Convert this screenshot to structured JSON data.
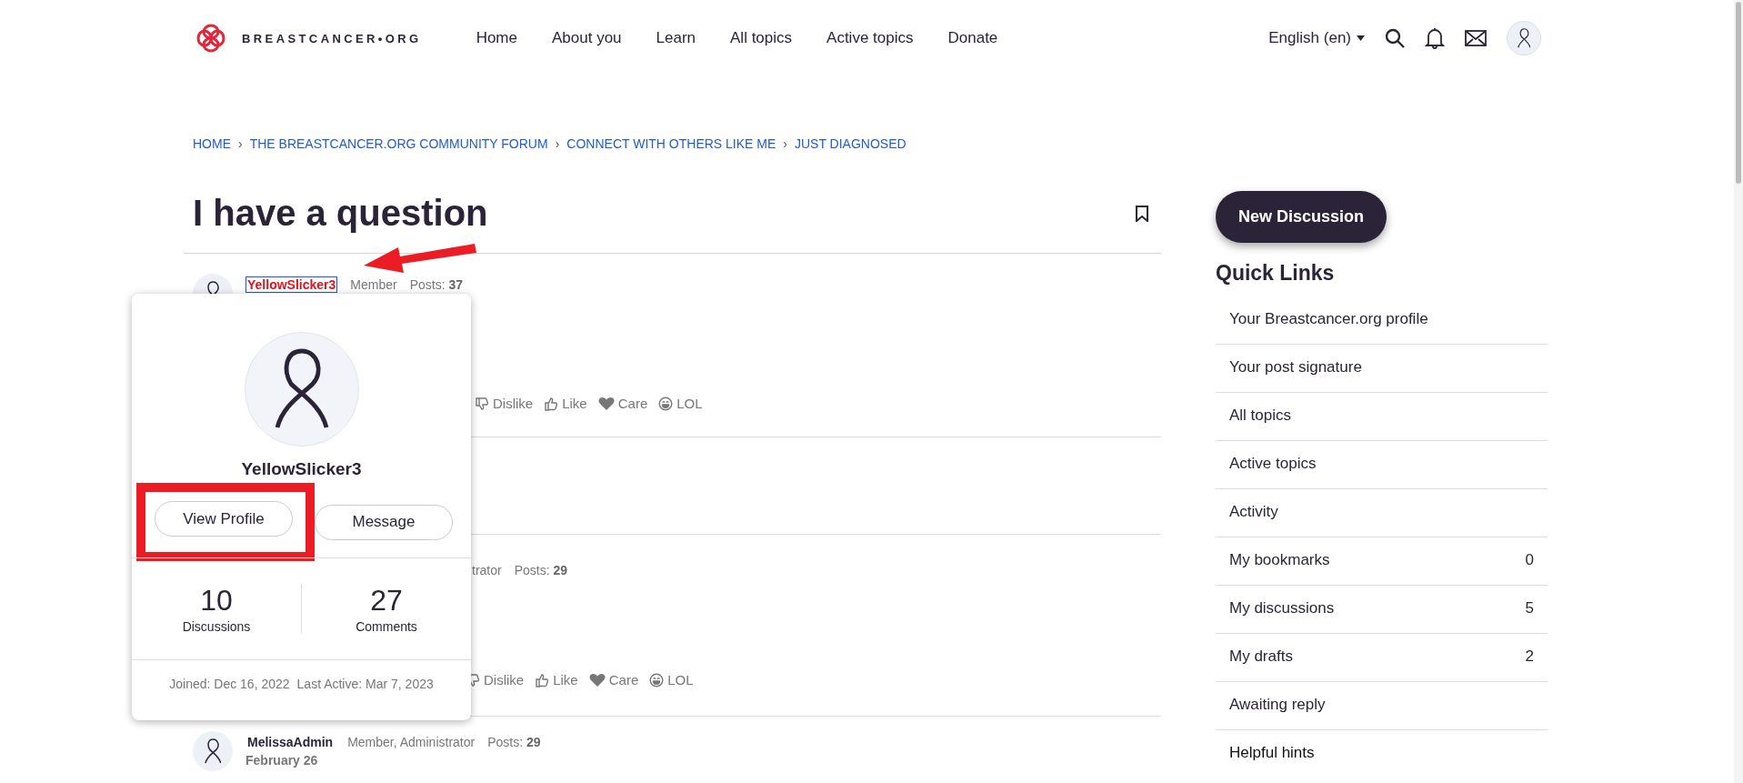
{
  "header": {
    "logo_text": "BREASTCANCER•ORG",
    "nav": [
      "Home",
      "About you",
      "Learn",
      "All topics",
      "Active topics",
      "Donate"
    ],
    "language": "English (en)"
  },
  "breadcrumb": [
    {
      "label": "HOME",
      "separator": "›"
    },
    {
      "label": "THE BREASTCANCER.ORG COMMUNITY FORUM",
      "separator": "›"
    },
    {
      "label": "CONNECT WITH OTHERS LIKE ME",
      "separator": "›"
    },
    {
      "label": "JUST DIAGNOSED"
    }
  ],
  "title": "I have a question",
  "posts": [
    {
      "kind": "author",
      "author": "YellowSlicker3",
      "focused": true,
      "role": "Member",
      "posts_label": "Posts:",
      "post_count": "37",
      "reactions": [
        {
          "kind": "dislike",
          "label": "Dislike"
        },
        {
          "kind": "like",
          "label": "Like"
        },
        {
          "kind": "care",
          "label": "Care"
        },
        {
          "kind": "lol",
          "label": "LOL"
        }
      ]
    },
    {
      "kind": "hidden"
    },
    {
      "kind": "covered",
      "role": "trator",
      "posts_label": "Posts:",
      "post_count": "29",
      "reactions": [
        {
          "kind": "dislike",
          "label": "Dislike"
        },
        {
          "kind": "like",
          "label": "Like"
        },
        {
          "kind": "care",
          "label": "Care"
        },
        {
          "kind": "lol",
          "label": "LOL"
        }
      ]
    },
    {
      "kind": "author",
      "author": "MelissaAdmin",
      "focused": false,
      "role": "Member, Administrator",
      "posts_label": "Posts:",
      "post_count": "29",
      "date": "February 26"
    }
  ],
  "popup": {
    "name": "YellowSlicker3",
    "buttons": [
      {
        "label": "View Profile",
        "highlighted": true
      },
      {
        "label": "Message",
        "highlighted": false
      }
    ],
    "stats": [
      {
        "value": "10",
        "label": "Discussions"
      },
      {
        "value": "27",
        "label": "Comments"
      }
    ],
    "joined": "Joined: Dec 16, 2022",
    "last_active": "Last Active: Mar 7, 2023"
  },
  "sidebar": {
    "new_discussion": "New Discussion",
    "title": "Quick Links",
    "links": [
      {
        "label": "Your Breastcancer.org profile"
      },
      {
        "label": "Your post signature"
      },
      {
        "label": "All topics"
      },
      {
        "label": "Active topics"
      },
      {
        "label": "Activity"
      },
      {
        "label": "My bookmarks",
        "count": "0"
      },
      {
        "label": "My discussions",
        "count": "5"
      },
      {
        "label": "My drafts",
        "count": "2"
      },
      {
        "label": "Awaiting reply"
      },
      {
        "label": "Helpful hints"
      }
    ]
  }
}
